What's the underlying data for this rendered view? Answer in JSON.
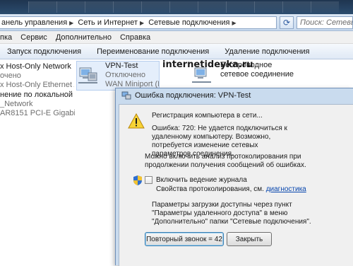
{
  "addressbar": {
    "breadcrumbs": [
      "анель управления",
      "Сеть и Интернет",
      "Сетевые подключения"
    ],
    "separator": "▶",
    "search_placeholder": "Поиск: Сетевые п"
  },
  "menubar": {
    "items": [
      "пка",
      "Сервис",
      "Дополнительно",
      "Справка"
    ]
  },
  "toolbar": {
    "buttons": [
      "Запуск подключения",
      "Переименование подключения",
      "Удаление подключения"
    ]
  },
  "connections": [
    {
      "name": "x Host-Only Network",
      "status": "очено",
      "device": "x Host-Only Ethernet Ad..."
    },
    {
      "name": "VPN-Test",
      "status": "Отключено",
      "device": "WAN Miniport (IKEv2)"
    },
    {
      "name": "Беспроводное сетевое соединение",
      "status": "",
      "device": ""
    },
    {
      "name": "нение по локальной сети",
      "status": "_Network",
      "device": "AR8151 PCI-E Gigabit Eth..."
    }
  ],
  "watermark": "internetideyka.ru",
  "dialog": {
    "title": "Ошибка подключения: VPN-Test",
    "status_line": "Регистрация компьютера в сети...",
    "error_text": "Ошибка: 720: Не удается подключиться к удаленному компьютеру. Возможно, потребуется изменение сетевых параметров соединения.",
    "analysis_text": "Можно включить анализ протоколирования при продолжении получения сообщений об ошибках.",
    "checkbox_label": "Включить ведение журнала",
    "properties_text": "Свойства протоколирования, см.",
    "diagnostics_link": "диагностика",
    "params_text": "Параметры загрузки доступны через пункт \"Параметры удаленного доступа\" в меню \"Дополнительно\" папки \"Сетевые подключения\".",
    "redial_button": "Повторный звонок = 42",
    "close_button": "Закрыть"
  },
  "colors": {
    "accent": "#2b4c6e",
    "link": "#0645ad",
    "dialog_frame": "#c9dbee"
  }
}
